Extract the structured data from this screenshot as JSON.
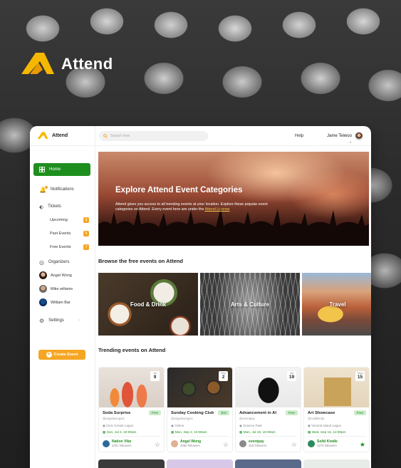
{
  "brand": {
    "name": "Attend"
  },
  "topbar": {
    "logo_text": "Attend",
    "search_placeholder": "Search here",
    "help": "Help",
    "user_name": "Jame Teiwoo"
  },
  "sidebar": {
    "home": "Home",
    "notifications": "Notifications",
    "tickets": "Tickets",
    "upcoming": "Upcoming",
    "upcoming_count": "3",
    "past_events": "Past Events",
    "past_count": "5",
    "free_events": "Free Events",
    "free_count": "7",
    "organizers": "Organizers",
    "organizer_list": [
      "Angel Wong",
      "Mike wiliams",
      "William Bar"
    ],
    "settings": "Settings",
    "create_event": "Create Event"
  },
  "hero": {
    "title": "Explore Attend Event Categories",
    "description": "Attend gives you access to all trending events at your location. Explore these popular event categories on Attend. Every event here are under the",
    "link": "Attend License"
  },
  "free_section": {
    "title": "Browse the free events on Attend",
    "categories": [
      "Food & Drink",
      "Arts & Culture",
      "Travel"
    ]
  },
  "trending_section": {
    "title": "Trending events on Attend",
    "events": [
      {
        "title": "Soda Surprise",
        "price": "Free",
        "handle": "@angelwongxi4",
        "location": "Civic Center Lagos",
        "time": "Sun, Jul 2, 10:00am",
        "month": "Jul",
        "day": "9",
        "organizer": "Nation Vibe",
        "followers": "2301 followers",
        "saved": false
      },
      {
        "title": "Sunday Cooking Club",
        "price": "$10",
        "handle": "@angelwongxi4",
        "location": "Online",
        "time": "Mon, Sep 2, 10:00am",
        "month": "Sep",
        "day": "2",
        "organizer": "Angel Wong",
        "followers": "2060 followers",
        "saved": false
      },
      {
        "title": "Advancement in AI",
        "price": "Free",
        "handle": "@eventpay",
        "location": "Science Park",
        "time": "Mon, Jul 19, 10:00am",
        "month": "Jul",
        "day": "19",
        "organizer": "eventpay",
        "followers": "320 followers",
        "saved": false
      },
      {
        "title": "Art Showcase",
        "price": "Free",
        "handle": "@solidkinde",
        "location": "Victoria Island Lagos",
        "time": "Wed, Sep 15, 12:00pm",
        "month": "Sept",
        "day": "15",
        "organizer": "Solid Kindle",
        "followers": "1270 followers",
        "saved": true
      }
    ]
  },
  "colors": {
    "accent": "#1e8f1e",
    "brand_yellow": "#f5a623"
  }
}
